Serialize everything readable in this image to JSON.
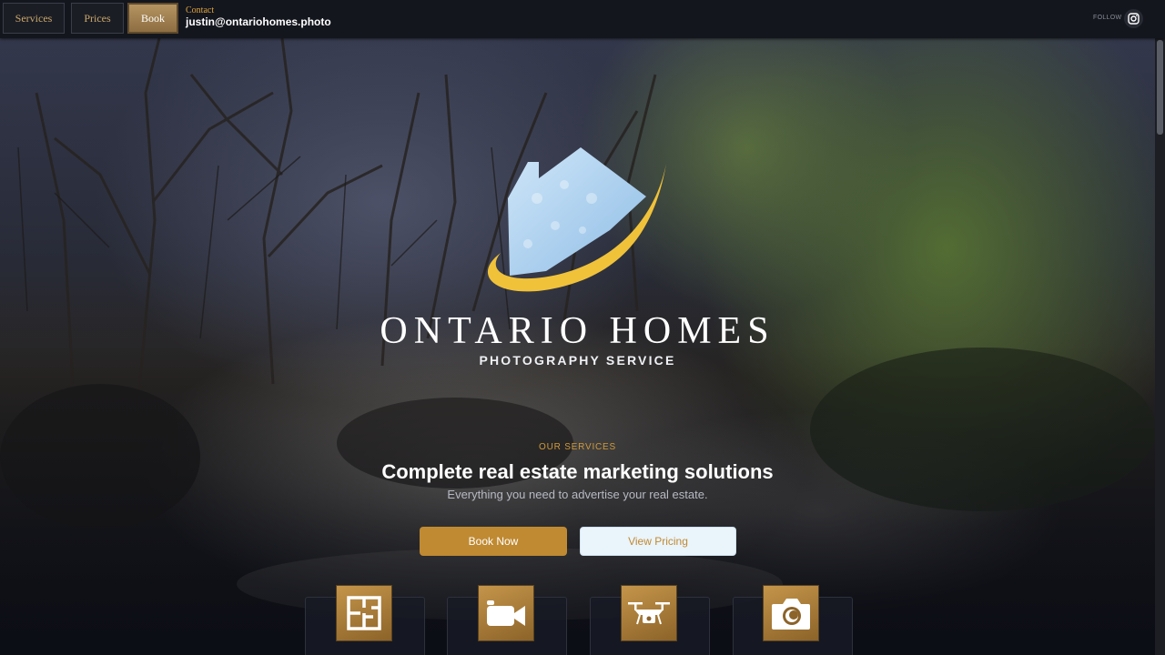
{
  "nav": {
    "services_label": "Services",
    "prices_label": "Prices",
    "book_label": "Book",
    "contact_label": "Contact",
    "contact_email": "justin@ontariohomes.photo",
    "follow_label": "FOLLOW",
    "social_icon": "instagram-icon"
  },
  "brand": {
    "name": "ONTARIO HOMES",
    "subtitle": "PHOTOGRAPHY SERVICE",
    "logo_icon": "house-logo-icon"
  },
  "hero": {
    "eyebrow": "OUR SERVICES",
    "headline": "Complete real estate marketing solutions",
    "subline": "Everything you need to advertise your real estate.",
    "book_button": "Book Now",
    "pricing_button": "View Pricing"
  },
  "services": [
    {
      "icon": "floor-plan-icon"
    },
    {
      "icon": "video-camera-icon"
    },
    {
      "icon": "drone-icon"
    },
    {
      "icon": "camera-icon"
    }
  ],
  "colors": {
    "accent_gold": "#c08a32",
    "contact_label": "#e0a63e",
    "topbar_bg": "#14161e",
    "logo_roof": "#b9d9f2",
    "logo_swoosh": "#f0c23a"
  }
}
